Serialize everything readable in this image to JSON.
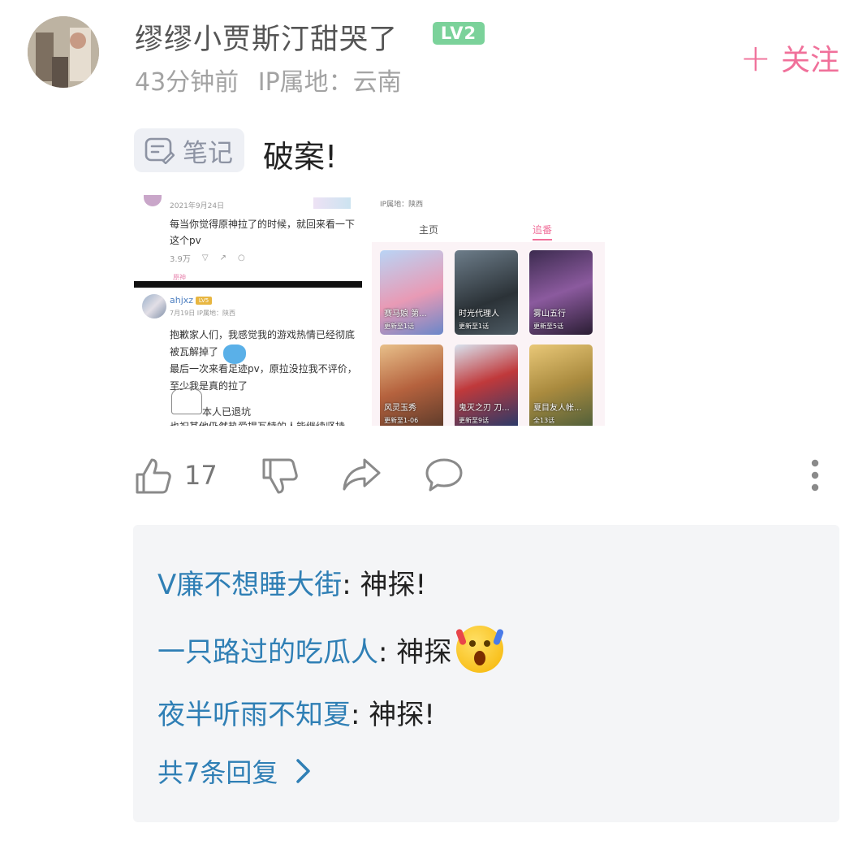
{
  "post": {
    "username": "缪缪小贾斯汀甜哭了",
    "level_badge": "LV2",
    "time_ago": "43分钟前",
    "ip_location": "IP属地：云南",
    "follow_label": "关注",
    "follow_plus": "+",
    "note_tag": "笔记",
    "title": "破案!",
    "like_count": "17",
    "accent_color": "#f0709a",
    "link_color": "#2f7fb5"
  },
  "collage": {
    "left": {
      "date": "2021年9月24日",
      "text1": "每当你觉得原神拉了的时候，就回来看一下这个pv",
      "likes": "3.9万",
      "tag": "原神",
      "user2": "ahjxz",
      "user2_level": "LV5",
      "user2_meta": "7月19日 IP属地：陕西",
      "text2": "抱歉家人们，我感觉我的游戏热情已经彻底被瓦解掉了",
      "text2b": "最后一次来看足迹pv，原拉没拉我不评价，至少我是真的拉了",
      "text3": "本人已退坑",
      "text4": "也祝其他仍然热爱提瓦特的人能继续坚持"
    },
    "right": {
      "ip": "IP属地：陕西",
      "tab_home": "主页",
      "tab_follow": "追番",
      "cards": [
        {
          "title": "赛马娘 第...",
          "update": "更新至1话"
        },
        {
          "title": "时光代理人",
          "update": "更新至1话"
        },
        {
          "title": "雾山五行",
          "update": "更新至5话"
        },
        {
          "title": "风灵玉秀",
          "update": "更新至1-06"
        },
        {
          "title": "鬼灭之刃 刀...",
          "update": "更新至9话"
        },
        {
          "title": "夏目友人帐...",
          "update": "全13话"
        }
      ]
    }
  },
  "replies": [
    {
      "user": "V廉不想睡大街",
      "text": ": 神探!"
    },
    {
      "user": "一只路过的吃瓜人",
      "text": ": 神探",
      "emoji": "shocked-face-emoji"
    },
    {
      "user": "夜半听雨不知夏",
      "text": ": 神探!"
    }
  ],
  "more_replies": "共7条回复"
}
